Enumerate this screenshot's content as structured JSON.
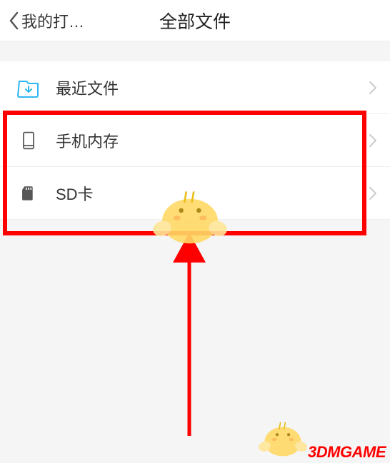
{
  "header": {
    "back_label": "我的打…",
    "title": "全部文件"
  },
  "items": [
    {
      "icon": "download-folder-icon",
      "label": "最近文件"
    },
    {
      "icon": "phone-icon",
      "label": "手机内存"
    },
    {
      "icon": "sd-card-icon",
      "label": "SD卡"
    }
  ],
  "watermark": "3DMGAME",
  "colors": {
    "highlight": "#ff0000",
    "accent": "#2db7f5"
  }
}
